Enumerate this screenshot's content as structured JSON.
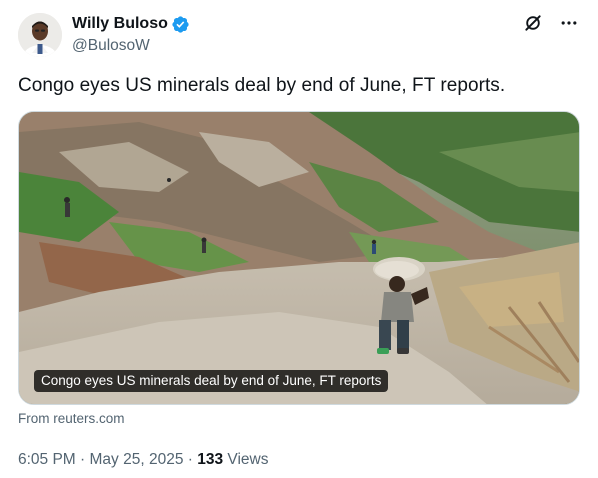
{
  "author": {
    "display_name": "Willy Buloso",
    "handle": "@BulosoW",
    "verified": true,
    "verified_color": "#1d9bf0"
  },
  "actions": {
    "grok_icon": "grok-slash-circle-icon",
    "more_icon": "more-horizontal-icon"
  },
  "tweet": {
    "text": "Congo eyes US minerals deal by end of June, FT reports."
  },
  "link_card": {
    "image_caption": "Congo eyes US minerals deal by end of June, FT reports",
    "source": "From reuters.com"
  },
  "meta": {
    "time": "6:05 PM",
    "separator_1": " · ",
    "date": "May 25, 2025",
    "separator_2": " · ",
    "views_count": "133",
    "views_label": " Views"
  },
  "colors": {
    "text_primary": "#0f1419",
    "text_secondary": "#536471",
    "border": "#cfd9de"
  }
}
